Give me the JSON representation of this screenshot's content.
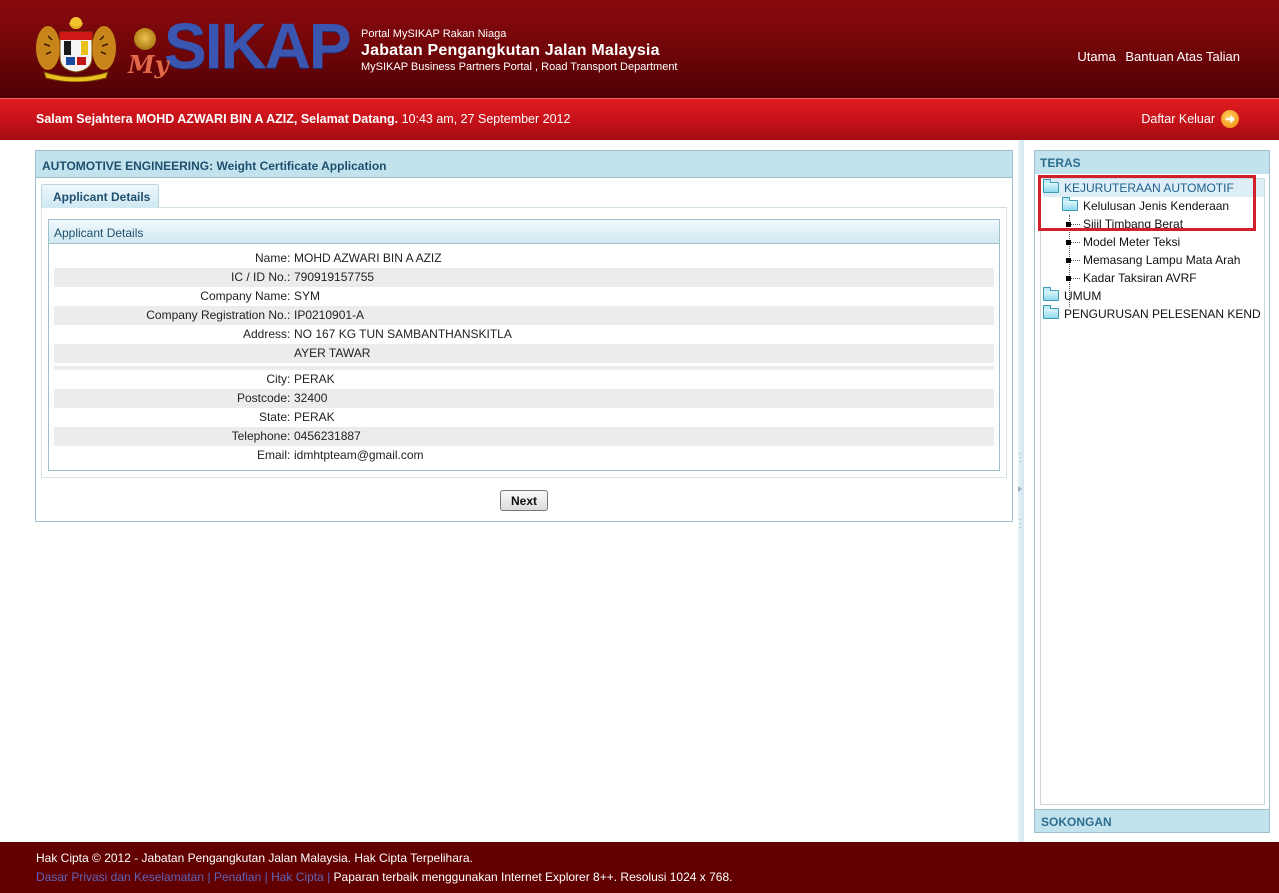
{
  "header": {
    "crest_alt": "jata-negara-crest",
    "logo_my": "My",
    "logo_sikap": "SIKAP",
    "portal_line1": "Portal MySIKAP  Rakan Niaga",
    "portal_line2": "Jabatan Pengangkutan Jalan Malaysia",
    "portal_line3": "MySIKAP  Business Partners Portal , Road Transport Department",
    "links": [
      "Utama",
      "Bantuan Atas Talian"
    ]
  },
  "welcome": {
    "greeting_bold": "Salam Sejahtera MOHD AZWARI BIN A AZIZ, Selamat Datang.",
    "datetime": " 10:43 am, 27 September 2012",
    "logout_label": "Daftar Keluar",
    "logout_icon": "arrow-right-circle-icon"
  },
  "main": {
    "title": "AUTOMOTIVE ENGINEERING: Weight Certificate Application",
    "tabs": [
      {
        "label": "Applicant Details",
        "active": true
      }
    ],
    "section_title": "Applicant Details",
    "fields": [
      {
        "label": "Name",
        "value": "MOHD AZWARI BIN A AZIZ"
      },
      {
        "label": "IC / ID No.",
        "value": "790919157755"
      },
      {
        "label": "Company Name",
        "value": "SYM"
      },
      {
        "label": "Company Registration No.",
        "value": "IP0210901-A"
      },
      {
        "label": "Address",
        "value": "NO 167 KG TUN SAMBANTHANSKITLA"
      },
      {
        "label": "",
        "value": "AYER TAWAR"
      },
      {
        "label": "City",
        "value": "PERAK"
      },
      {
        "label": "Postcode",
        "value": "32400"
      },
      {
        "label": "State",
        "value": "PERAK"
      },
      {
        "label": "Telephone",
        "value": "0456231887"
      },
      {
        "label": "Email",
        "value": "idmhtpteam@gmail.com"
      }
    ],
    "separator": " : ",
    "next_label": "Next"
  },
  "sidebar": {
    "title": "TERAS",
    "tree": [
      {
        "label": "KEJURUTERAAN AUTOMOTIF",
        "type": "folder-open",
        "selected": true
      },
      {
        "label": "Kelulusan Jenis Kenderaan",
        "type": "folder"
      },
      {
        "label": "Sijil Timbang Berat",
        "type": "leaf"
      },
      {
        "label": "Model Meter Teksi",
        "type": "leaf"
      },
      {
        "label": "Memasang Lampu Mata Arah",
        "type": "leaf"
      },
      {
        "label": "Kadar Taksiran AVRF",
        "type": "leaf"
      },
      {
        "label": "UMUM",
        "type": "folder"
      },
      {
        "label": "PENGURUSAN PELESENAN KEND",
        "type": "folder"
      }
    ],
    "footer_title": "SOKONGAN",
    "highlight_color": "#d0202a"
  },
  "footer": {
    "copyright": "Hak Cipta © 2012 - Jabatan Pengangkutan Jalan Malaysia. Hak Cipta Terpelihara.",
    "links": [
      "Dasar Privasi dan Keselamatan",
      "Penafian",
      "Hak Cipta"
    ],
    "note": " Paparan terbaik menggunakan Internet Explorer 8++. Resolusi 1024 x 768."
  },
  "colors": {
    "header_red": "#6e0508",
    "welcome_red": "#c8121a",
    "panel_blue": "#c2e3ee",
    "footer_maroon": "#620000"
  }
}
